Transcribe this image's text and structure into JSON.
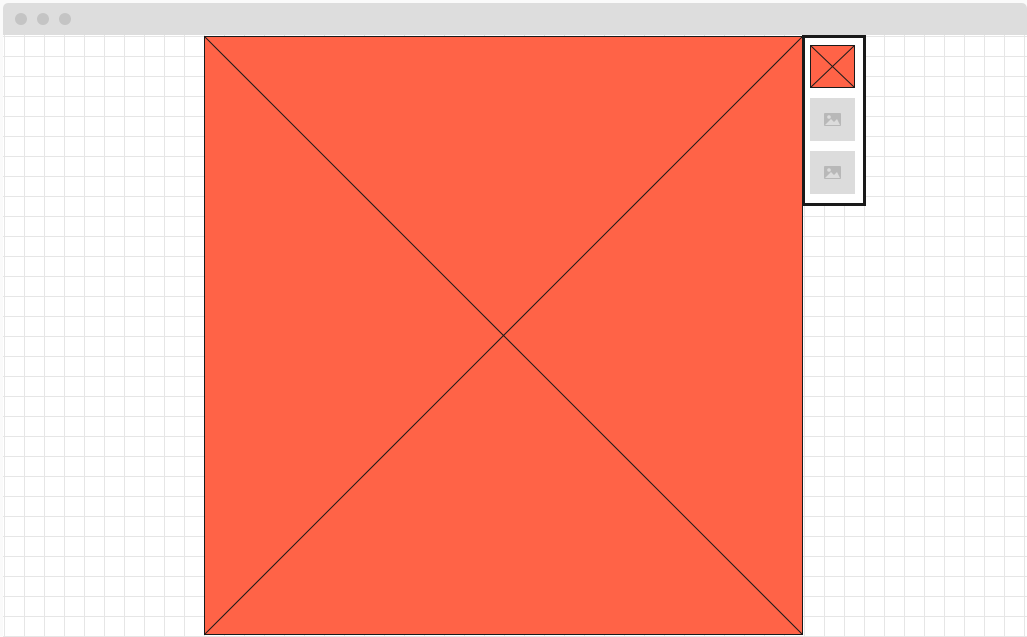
{
  "window": {
    "titlebar_color": "#dddddd",
    "control_dot_color": "#c4c4c4",
    "controls": [
      "close-dot",
      "minimize-dot",
      "maximize-dot"
    ]
  },
  "canvas": {
    "background": "#ffffff",
    "grid_line_color": "#e6e6e6"
  },
  "gallery": {
    "main_image": {
      "type": "image-placeholder",
      "fill": "#ff6347",
      "stroke": "#1a1a1a"
    },
    "thumbnails": [
      {
        "type": "image-placeholder",
        "selected": true,
        "fill": "#ff6347"
      },
      {
        "type": "image-icon-placeholder",
        "selected": false,
        "fill": "#dcdcdc",
        "icon": "image-icon"
      },
      {
        "type": "image-icon-placeholder",
        "selected": false,
        "fill": "#dcdcdc",
        "icon": "image-icon"
      }
    ]
  }
}
